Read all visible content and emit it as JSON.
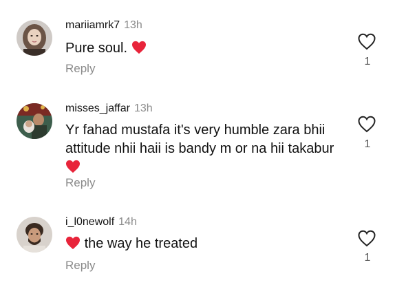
{
  "comments": [
    {
      "username": "mariiamrk7",
      "time": "13h",
      "text": "Pure soul.",
      "reply_label": "Reply",
      "likes": "1"
    },
    {
      "username": "misses_jaffar",
      "time": "13h",
      "text_line1": "Yr fahad mustafa it's very humble zara bhii",
      "text_line2": "attitude nhii haii is bandy m or na hii takabur",
      "reply_label": "Reply",
      "likes": "1"
    },
    {
      "username": "i_l0newolf",
      "time": "14h",
      "text": "the way he treated",
      "reply_label": "Reply",
      "likes": "1"
    }
  ],
  "colors": {
    "heart_emoji": "#e8243a",
    "muted_text": "#8a8a8a",
    "primary_text": "#111111"
  },
  "icons": {
    "like": "heart-outline-icon",
    "emoji": "red-heart-emoji-icon"
  }
}
